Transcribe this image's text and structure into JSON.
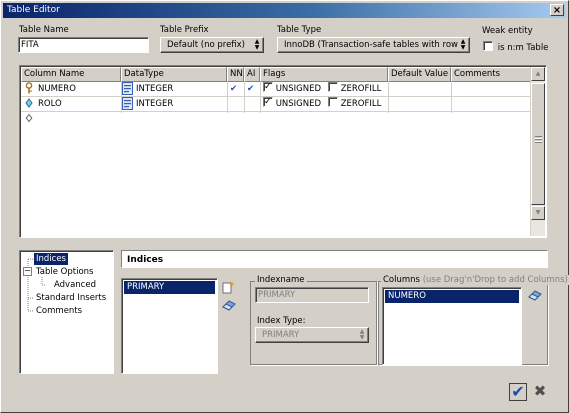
{
  "window": {
    "title": "Table Editor",
    "close": "×"
  },
  "fields": {
    "table_name_label": "Table Name",
    "table_name_value": "FITA",
    "table_prefix_label": "Table Prefix",
    "table_prefix_value": "Default (no prefix)",
    "table_type_label": "Table Type",
    "table_type_value": "InnoDB  (Transaction-safe tables with row loc",
    "weak_entity_label": "Weak entity",
    "is_nm_label": "is n:m Table"
  },
  "grid": {
    "headers": [
      "Column Name",
      "DataType",
      "NN",
      "AI",
      "Flags",
      "Default Value",
      "Comments"
    ],
    "rows": [
      {
        "name": "NUMERO",
        "type": "INTEGER",
        "nn": "✔",
        "ai": "✔",
        "unsigned": "UNSIGNED",
        "zerofill": "ZEROFILL"
      },
      {
        "name": "ROLO",
        "type": "INTEGER",
        "nn": "",
        "ai": "",
        "unsigned": "UNSIGNED",
        "zerofill": "ZEROFILL"
      }
    ]
  },
  "tree": {
    "items": [
      "Indices",
      "Table Options",
      "Advanced",
      "Standard Inserts",
      "Comments"
    ]
  },
  "indices": {
    "header": "Indices",
    "list": [
      "PRIMARY"
    ],
    "indexname_label": "Indexname",
    "indexname_value": "PRIMARY",
    "index_type_label": "Index Type:",
    "index_type_value": "PRIMARY",
    "columns_label": "Columns",
    "columns_hint": "(use Drag'n'Drop to add Columns)",
    "columns_list": [
      "NUMERO"
    ]
  },
  "colors": {
    "selection": "#0a246a",
    "face": "#d4d0c8",
    "key_icon": "#c8a040",
    "check": "#1a4db5"
  }
}
